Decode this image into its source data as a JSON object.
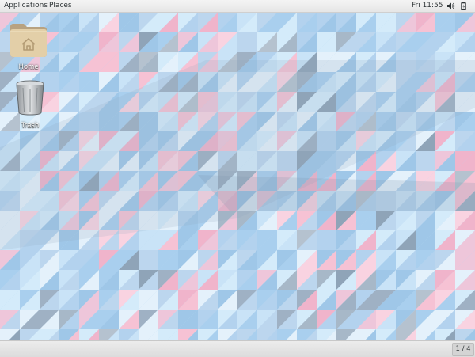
{
  "topbar": {
    "applications_label": "Applications",
    "places_label": "Places",
    "clock": "Fri 11:55",
    "volume_icon": "speaker-icon",
    "battery_icon": "battery-icon"
  },
  "desktop": {
    "icons": [
      {
        "label": "Home",
        "icon": "folder-home-icon"
      },
      {
        "label": "Trash",
        "icon": "trash-can-icon"
      }
    ]
  },
  "bottombar": {
    "workspace_indicator": "1 / 4"
  },
  "colors": {
    "wallpaper_base": "#b9d9f2",
    "wallpaper_pink": "#f6c2d4",
    "wallpaper_gray": "#9fb1c4",
    "panel_bg": "#ececec"
  }
}
